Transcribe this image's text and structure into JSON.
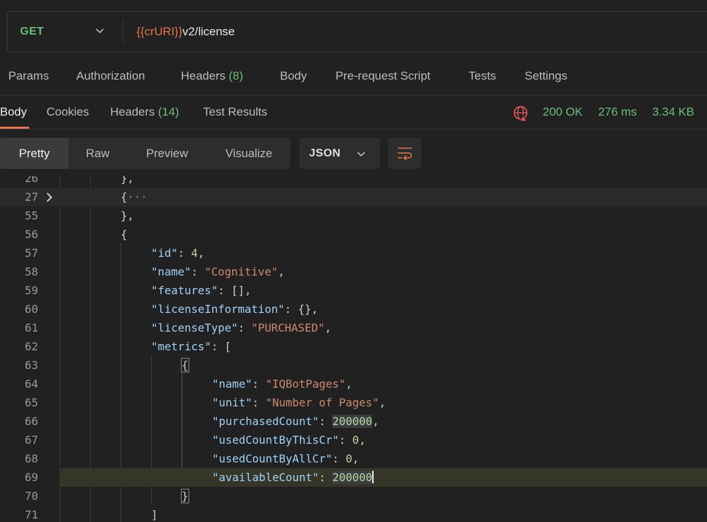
{
  "request": {
    "method": "GET",
    "url_var": "{{crURI}}",
    "url_path": "v2/license"
  },
  "request_tabs": [
    {
      "label": "Params"
    },
    {
      "label": "Authorization"
    },
    {
      "label": "Headers",
      "count": "(8)"
    },
    {
      "label": "Body"
    },
    {
      "label": "Pre-request Script"
    },
    {
      "label": "Tests"
    },
    {
      "label": "Settings"
    }
  ],
  "response_tabs": [
    {
      "label": "Body"
    },
    {
      "label": "Cookies"
    },
    {
      "label": "Headers",
      "count": "(14)"
    },
    {
      "label": "Test Results"
    }
  ],
  "response_status": {
    "code": "200 OK",
    "time": "276 ms",
    "size": "3.34 KB"
  },
  "view_modes": [
    "Pretty",
    "Raw",
    "Preview",
    "Visualize"
  ],
  "format": "JSON",
  "code_lines": [
    {
      "num": "26",
      "text": "},"
    },
    {
      "num": "27",
      "text": "{"
    },
    {
      "num": "55",
      "text": "},"
    },
    {
      "num": "56",
      "text": "{"
    },
    {
      "num": "57",
      "key": "\"id\"",
      "value": "4",
      "vtype": "n",
      "tail": ","
    },
    {
      "num": "58",
      "key": "\"name\"",
      "value": "\"Cognitive\"",
      "vtype": "s",
      "tail": ","
    },
    {
      "num": "59",
      "key": "\"features\"",
      "value": "[]",
      "vtype": "p",
      "tail": ","
    },
    {
      "num": "60",
      "key": "\"licenseInformation\"",
      "value": "{}",
      "vtype": "p",
      "tail": ","
    },
    {
      "num": "61",
      "key": "\"licenseType\"",
      "value": "\"PURCHASED\"",
      "vtype": "s",
      "tail": ","
    },
    {
      "num": "62",
      "key": "\"metrics\"",
      "value": "[",
      "vtype": "p",
      "tail": ""
    },
    {
      "num": "63",
      "text": "{"
    },
    {
      "num": "64",
      "key": "\"name\"",
      "value": "\"IQBotPages\"",
      "vtype": "s",
      "tail": ","
    },
    {
      "num": "65",
      "key": "\"unit\"",
      "value": "\"Number of Pages\"",
      "vtype": "s",
      "tail": ","
    },
    {
      "num": "66",
      "key": "\"purchasedCount\"",
      "value": "200000",
      "vtype": "n",
      "tail": ","
    },
    {
      "num": "67",
      "key": "\"usedCountByThisCr\"",
      "value": "0",
      "vtype": "n",
      "tail": ","
    },
    {
      "num": "68",
      "key": "\"usedCountByAllCr\"",
      "value": "0",
      "vtype": "n",
      "tail": ","
    },
    {
      "num": "69",
      "key": "\"availableCount\"",
      "value": "200000",
      "vtype": "n",
      "tail": ""
    },
    {
      "num": "70",
      "text": "}"
    },
    {
      "num": "71",
      "text": "]"
    }
  ],
  "fold_ellipsis": "···",
  "colors": {
    "accent": "#e8744a",
    "success": "#6bbf7a",
    "error_icon": "#e05353"
  }
}
